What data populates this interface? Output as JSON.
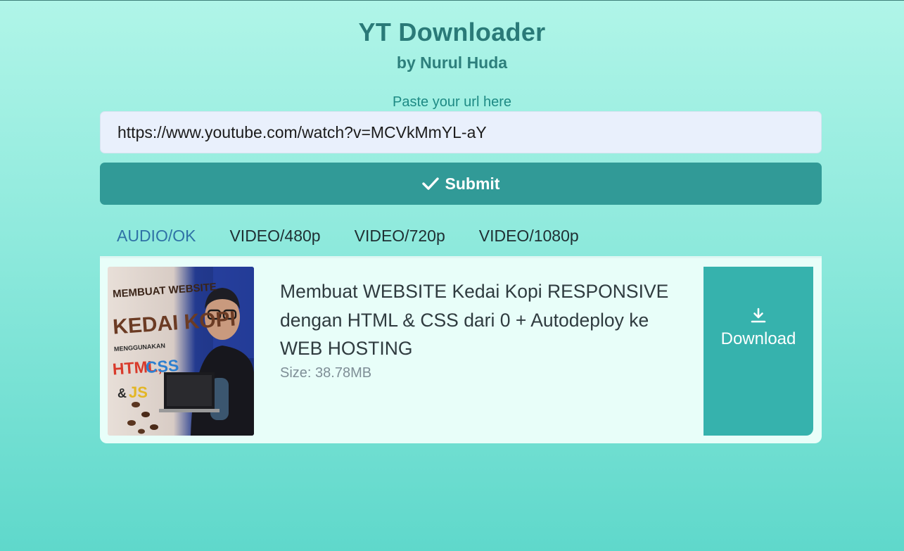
{
  "header": {
    "title": "YT Downloader",
    "author": "by Nurul Huda"
  },
  "form": {
    "url_label": "Paste your url here",
    "url_value": "https://www.youtube.com/watch?v=MCVkMmYL-aY",
    "submit_label": "Submit",
    "submit_icon": "check-icon"
  },
  "tabs": [
    {
      "label": "AUDIO/OK",
      "active": true
    },
    {
      "label": "VIDEO/480p",
      "active": false
    },
    {
      "label": "VIDEO/720p",
      "active": false
    },
    {
      "label": "VIDEO/1080p",
      "active": false
    }
  ],
  "result": {
    "title": "Membuat WEBSITE Kedai Kopi RESPONSIVE dengan HTML & CSS dari 0 + Autodeploy ke WEB HOSTING",
    "size": "Size: 38.78MB",
    "download_label": "Download",
    "download_icon": "download-icon",
    "thumbnail": {
      "line1": "MEMBUAT WEBSITE",
      "line2": "KEDAI KOPI",
      "line3": "MENGGUNAKAN",
      "line4a": "HTML,",
      "line4b": "CSS",
      "line5a": "&",
      "line5b": "JS"
    }
  },
  "colors": {
    "accent": "#319a97",
    "download": "#36b2ad",
    "active_tab": "#2f72a6",
    "title": "#2a7a78"
  }
}
